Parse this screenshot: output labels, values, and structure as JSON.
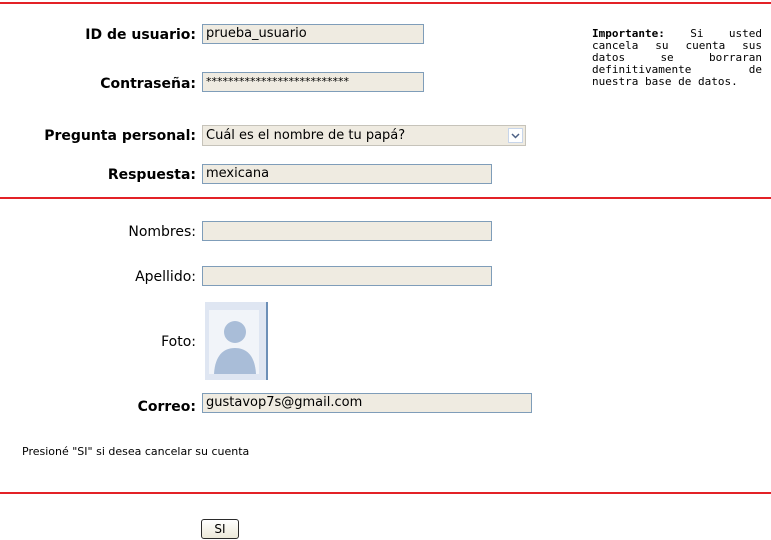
{
  "account": {
    "user_id_label": "ID de usuario:",
    "user_id_value": "prueba_usuario",
    "password_label": "Contraseña:",
    "password_value": "**************************",
    "question_label": "Pregunta personal:",
    "question_value": "Cuál es el nombre de tu papá?",
    "answer_label": "Respuesta:",
    "answer_value": "mexicana"
  },
  "notice": {
    "heading": "Importante:",
    "body": "Si usted cancela su cuenta sus datos se borraran definitivamente de nuestra base de datos."
  },
  "profile": {
    "names_label": "Nombres:",
    "names_value": "",
    "surname_label": "Apellido:",
    "surname_value": "",
    "photo_label": "Foto:",
    "email_label": "Correo:",
    "email_value": "gustavop7s@gmail.com"
  },
  "confirm": {
    "message": "Presioné \"SI\" si desea cancelar su cuenta",
    "button_label": "SI"
  },
  "colors": {
    "divider": "#e32126",
    "field_bg": "#efebe1",
    "field_border": "#7f9db9"
  }
}
